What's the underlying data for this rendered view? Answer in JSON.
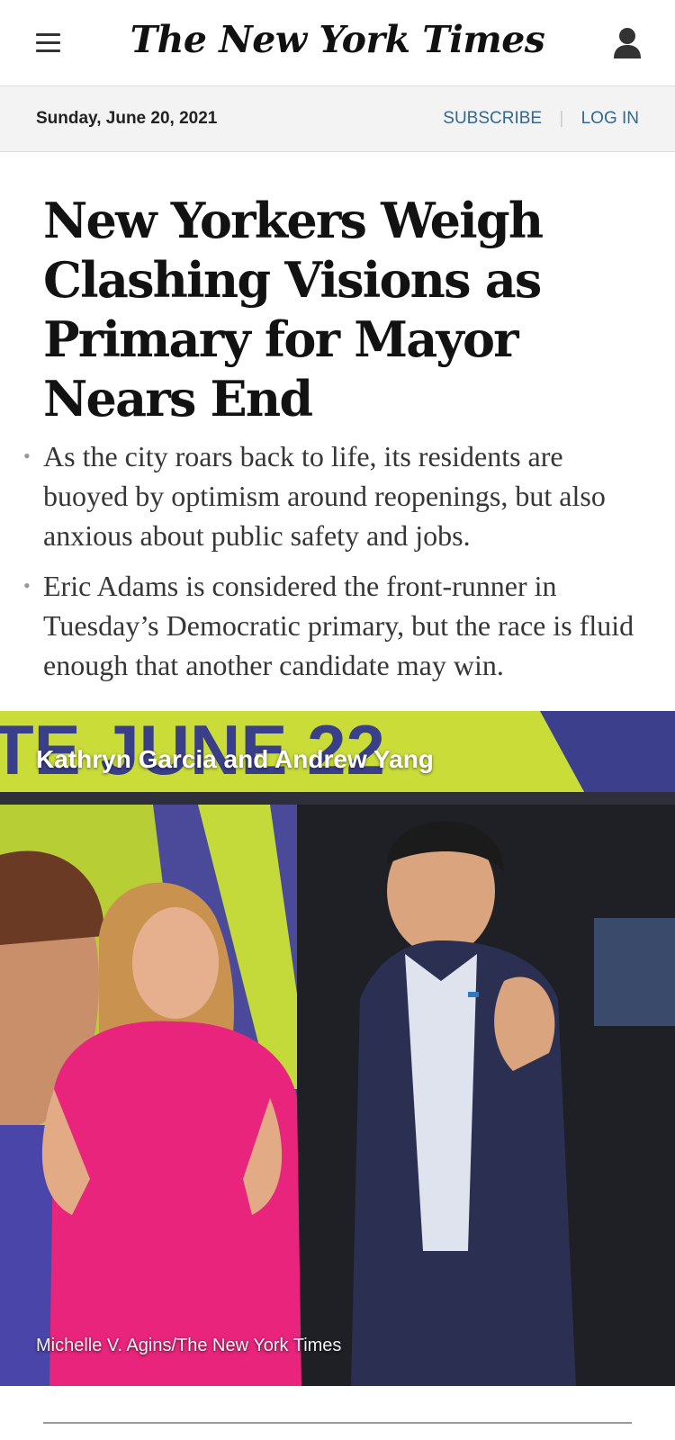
{
  "header": {
    "menu_icon": "hamburger-menu-icon",
    "logo_text": "The New York Times",
    "user_icon": "user-account-icon"
  },
  "datebar": {
    "date": "Sunday, June 20, 2021",
    "subscribe": "SUBSCRIBE",
    "login": "LOG IN",
    "link_color": "#326891"
  },
  "article": {
    "headline": "New Yorkers Weigh Clashing Visions as Primary for Mayor Nears End",
    "summary": [
      "As the city roars back to life, its residents are buoyed by optimism around reopenings, but also anxious about public safety and jobs.",
      "Eric Adams is considered the front-runner in Tuesday’s Democratic primary, but the race is fluid enough that another candidate may win."
    ],
    "photo": {
      "caption": "Kathryn Garcia and Andrew Yang",
      "credit": "Michelle V. Agins/The New York Times",
      "banner_text": "TE JUNE 22"
    }
  }
}
